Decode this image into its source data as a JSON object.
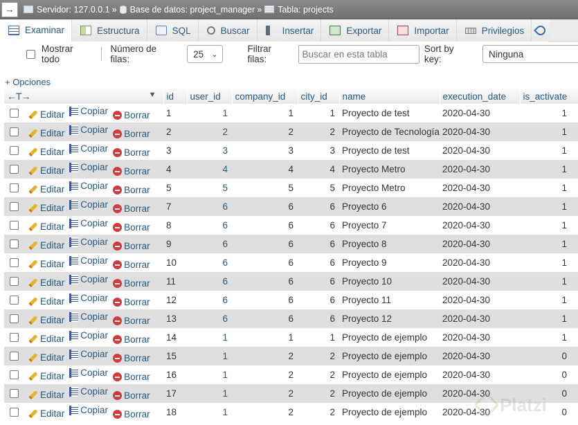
{
  "breadcrumb": {
    "server": "Servidor: 127.0.0.1",
    "database": "Base de datos: project_manager",
    "table": "Tabla: projects",
    "separator": "»"
  },
  "tabs": [
    {
      "label": "Examinar",
      "icon": "browse-icon",
      "active": true
    },
    {
      "label": "Estructura",
      "icon": "structure-icon"
    },
    {
      "label": "SQL",
      "icon": "sql-icon"
    },
    {
      "label": "Buscar",
      "icon": "search-icon"
    },
    {
      "label": "Insertar",
      "icon": "insert-icon"
    },
    {
      "label": "Exportar",
      "icon": "export-icon"
    },
    {
      "label": "Importar",
      "icon": "import-icon"
    },
    {
      "label": "Privilegios",
      "icon": "privileges-icon"
    }
  ],
  "controls": {
    "show_all": "Mostrar todo",
    "rows_label": "Número de filas:",
    "rows_value": "25",
    "filter_label": "Filtrar filas:",
    "filter_placeholder": "Buscar en esta tabla",
    "sort_label": "Sort by key:",
    "sort_value": "Ninguna"
  },
  "options_link": "+ Opciones",
  "actions": {
    "edit": "Editar",
    "copy": "Copiar",
    "delete": "Borrar"
  },
  "columns": [
    "id",
    "user_id",
    "company_id",
    "city_id",
    "name",
    "execution_date",
    "is_activate"
  ],
  "rows": [
    [
      "1",
      "1",
      "1",
      "1",
      "Proyecto de test",
      "2020-04-30",
      "1"
    ],
    [
      "2",
      "2",
      "2",
      "2",
      "Proyecto de Tecnología",
      "2020-04-30",
      "1"
    ],
    [
      "3",
      "3",
      "3",
      "3",
      "Proyecto de test",
      "2020-04-30",
      "1"
    ],
    [
      "4",
      "4",
      "4",
      "4",
      "Proyecto Metro",
      "2020-04-30",
      "1"
    ],
    [
      "5",
      "5",
      "5",
      "5",
      "Proyecto Metro",
      "2020-04-30",
      "1"
    ],
    [
      "7",
      "6",
      "6",
      "6",
      "Proyecto 6",
      "2020-04-30",
      "1"
    ],
    [
      "8",
      "6",
      "6",
      "6",
      "Proyecto 7",
      "2020-04-30",
      "1"
    ],
    [
      "9",
      "6",
      "6",
      "6",
      "Proyecto 8",
      "2020-04-30",
      "1"
    ],
    [
      "10",
      "6",
      "6",
      "6",
      "Proyecto 9",
      "2020-04-30",
      "1"
    ],
    [
      "11",
      "6",
      "6",
      "6",
      "Proyecto 10",
      "2020-04-30",
      "1"
    ],
    [
      "12",
      "6",
      "6",
      "6",
      "Proyecto 11",
      "2020-04-30",
      "1"
    ],
    [
      "13",
      "6",
      "6",
      "6",
      "Proyecto 12",
      "2020-04-30",
      "1"
    ],
    [
      "14",
      "1",
      "1",
      "1",
      "Proyecto de ejemplo",
      "2020-04-30",
      "1"
    ],
    [
      "15",
      "1",
      "2",
      "2",
      "Proyecto de ejemplo",
      "2020-04-30",
      "0"
    ],
    [
      "16",
      "1",
      "2",
      "2",
      "Proyecto de ejemplo",
      "2020-04-30",
      "0"
    ],
    [
      "17",
      "1",
      "2",
      "2",
      "Proyecto de ejemplo",
      "2020-04-30",
      "0"
    ],
    [
      "18",
      "1",
      "2",
      "2",
      "Proyecto de ejemplo",
      "2020-04-30",
      "0"
    ]
  ],
  "watermark": "Platzi"
}
